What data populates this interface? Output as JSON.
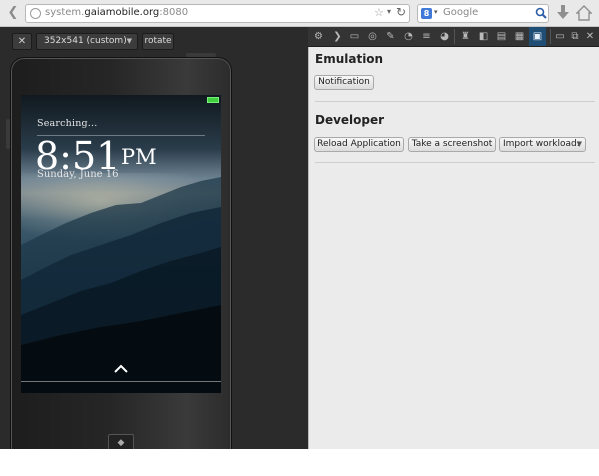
{
  "browser": {
    "url_host_prefix": "system.",
    "url_domain": "gaiamobile.org",
    "url_port": ":8080",
    "search_placeholder": "Google",
    "search_engine_letter": "8"
  },
  "responsive": {
    "close_label": "✕",
    "preset_label": "352x541 (custom)",
    "rotate_label": "rotate"
  },
  "lockscreen": {
    "status": "Searching...",
    "time": "8:51",
    "ampm": "PM",
    "date": "Sunday, June 16"
  },
  "devtools": {
    "icons": [
      "gear-icon",
      "console-icon",
      "inspector-icon",
      "debugger-icon",
      "style-editor-icon",
      "profiler-icon",
      "network-icon",
      "firefox-os-icon",
      "paint-icon",
      "scratchpad-icon",
      "responsive-icon",
      "measure-icon",
      "app-manager-icon",
      "dock-icon",
      "popout-icon",
      "close-icon"
    ]
  },
  "panel": {
    "emulation": {
      "title": "Emulation",
      "notification_button": "Notification"
    },
    "developer": {
      "title": "Developer",
      "reload_button": "Reload Application",
      "screenshot_button": "Take a screenshot",
      "workload_select": "Import workload:"
    }
  }
}
